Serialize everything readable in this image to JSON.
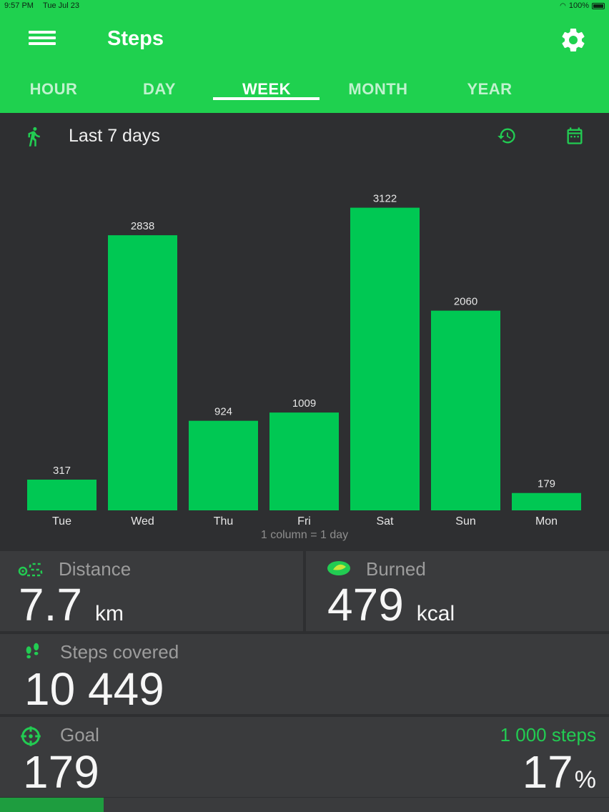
{
  "status": {
    "time": "9:57 PM",
    "date": "Tue Jul 23",
    "battery": "100%"
  },
  "app": {
    "title": "Steps"
  },
  "tabs": [
    {
      "label": "HOUR",
      "active": false
    },
    {
      "label": "DAY",
      "active": false
    },
    {
      "label": "WEEK",
      "active": true
    },
    {
      "label": "MONTH",
      "active": false
    },
    {
      "label": "YEAR",
      "active": false
    }
  ],
  "chart_header": {
    "range_label": "Last 7 days"
  },
  "chart_data": {
    "type": "bar",
    "categories": [
      "Tue",
      "Wed",
      "Thu",
      "Fri",
      "Sat",
      "Sun",
      "Mon"
    ],
    "values": [
      317,
      2838,
      924,
      1009,
      3122,
      2060,
      179
    ],
    "subtitle": "1 column = 1 day",
    "bar_color": "#00c853",
    "ylim": [
      0,
      3200
    ]
  },
  "stats": {
    "distance": {
      "label": "Distance",
      "value": "7.7",
      "unit": "km"
    },
    "burned": {
      "label": "Burned",
      "value": "479",
      "unit": "kcal"
    },
    "steps": {
      "label": "Steps covered",
      "value": "10 449"
    },
    "goal": {
      "label": "Goal",
      "target": "1 000 steps",
      "value": "179",
      "percent": "17",
      "percent_unit": "%",
      "progress": 0.17
    }
  },
  "colors": {
    "accent": "#1fd14f",
    "background": "#2e2f31",
    "card": "#3a3b3d"
  },
  "icons": [
    "menu-icon",
    "gear-icon",
    "walk-icon",
    "history-icon",
    "calendar-icon",
    "distance-icon",
    "burned-icon",
    "footsteps-icon",
    "goal-icon"
  ]
}
